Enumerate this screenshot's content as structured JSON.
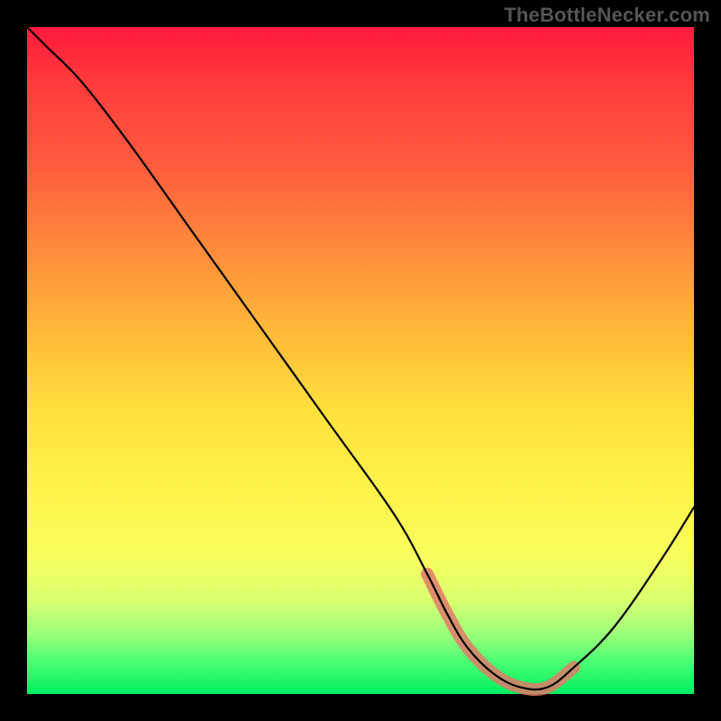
{
  "watermark": "TheBottleNecker.com",
  "chart_data": {
    "type": "line",
    "title": "",
    "xlabel": "",
    "ylabel": "",
    "xlim": [
      0,
      100
    ],
    "ylim": [
      0,
      100
    ],
    "x": [
      0,
      3,
      8,
      15,
      25,
      35,
      45,
      55,
      60,
      63,
      66,
      70,
      74,
      78,
      82,
      88,
      95,
      100
    ],
    "values": [
      100,
      97,
      92,
      83,
      69,
      55,
      41,
      27,
      18,
      12,
      7,
      3,
      1,
      1,
      4,
      10,
      20,
      28
    ],
    "ok_band_x": [
      61,
      80
    ],
    "gradient": {
      "top_color": "#ff1a3c",
      "bottom_color": "#00f060"
    },
    "grid": false,
    "legend": false
  }
}
